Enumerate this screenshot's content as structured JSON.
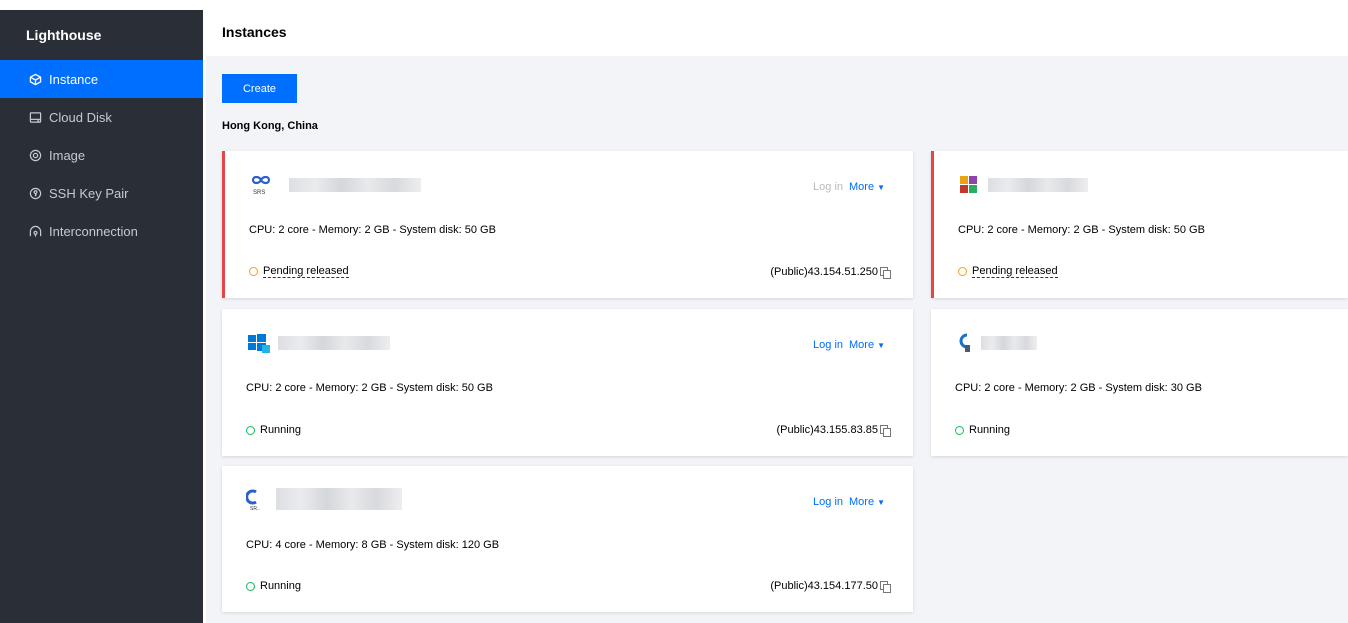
{
  "sidebar": {
    "title": "Lighthouse",
    "items": [
      {
        "label": "Instance",
        "icon": "cube-icon",
        "active": true
      },
      {
        "label": "Cloud Disk",
        "icon": "disk-icon",
        "active": false
      },
      {
        "label": "Image",
        "icon": "image-disc-icon",
        "active": false
      },
      {
        "label": "SSH Key Pair",
        "icon": "key-pair-icon",
        "active": false
      },
      {
        "label": "Interconnection",
        "icon": "interconnection-icon",
        "active": false
      }
    ]
  },
  "header": {
    "title": "Instances"
  },
  "toolbar": {
    "create_label": "Create"
  },
  "region": {
    "label": "Hong Kong, China"
  },
  "colors": {
    "accent": "#006eff",
    "sidebar_bg": "#2a2e36",
    "warning_border": "#e54545",
    "running": "#0abf5b",
    "pending": "#ff9c19"
  },
  "instances": [
    {
      "logo": "srs-logo-icon",
      "logo_text": "SRS",
      "login_label": "Log in",
      "login_enabled": false,
      "more_label": "More",
      "spec": "CPU: 2 core - Memory: 2 GB - System disk: 50 GB",
      "status": "Pending released",
      "ip": "(Public)43.154.51.250"
    },
    {
      "logo": "multicolor-app-logo-icon",
      "spec": "CPU: 2 core - Memory: 2 GB - System disk: 50 GB",
      "status": "Pending released"
    },
    {
      "logo": "windows-logo-icon",
      "login_label": "Log in",
      "login_enabled": true,
      "more_label": "More",
      "spec": "CPU: 2 core - Memory: 2 GB - System disk: 50 GB",
      "status": "Running",
      "ip": "(Public)43.155.83.85"
    },
    {
      "logo": "app-logo-icon",
      "spec": "CPU: 2 core - Memory: 2 GB - System disk: 30 GB",
      "status": "Running"
    },
    {
      "logo": "srs-logo-icon",
      "logo_text": "SR..",
      "login_label": "Log in",
      "login_enabled": true,
      "more_label": "More",
      "spec": "CPU: 4 core - Memory: 8 GB - System disk: 120 GB",
      "status": "Running",
      "ip": "(Public)43.154.177.50"
    }
  ]
}
